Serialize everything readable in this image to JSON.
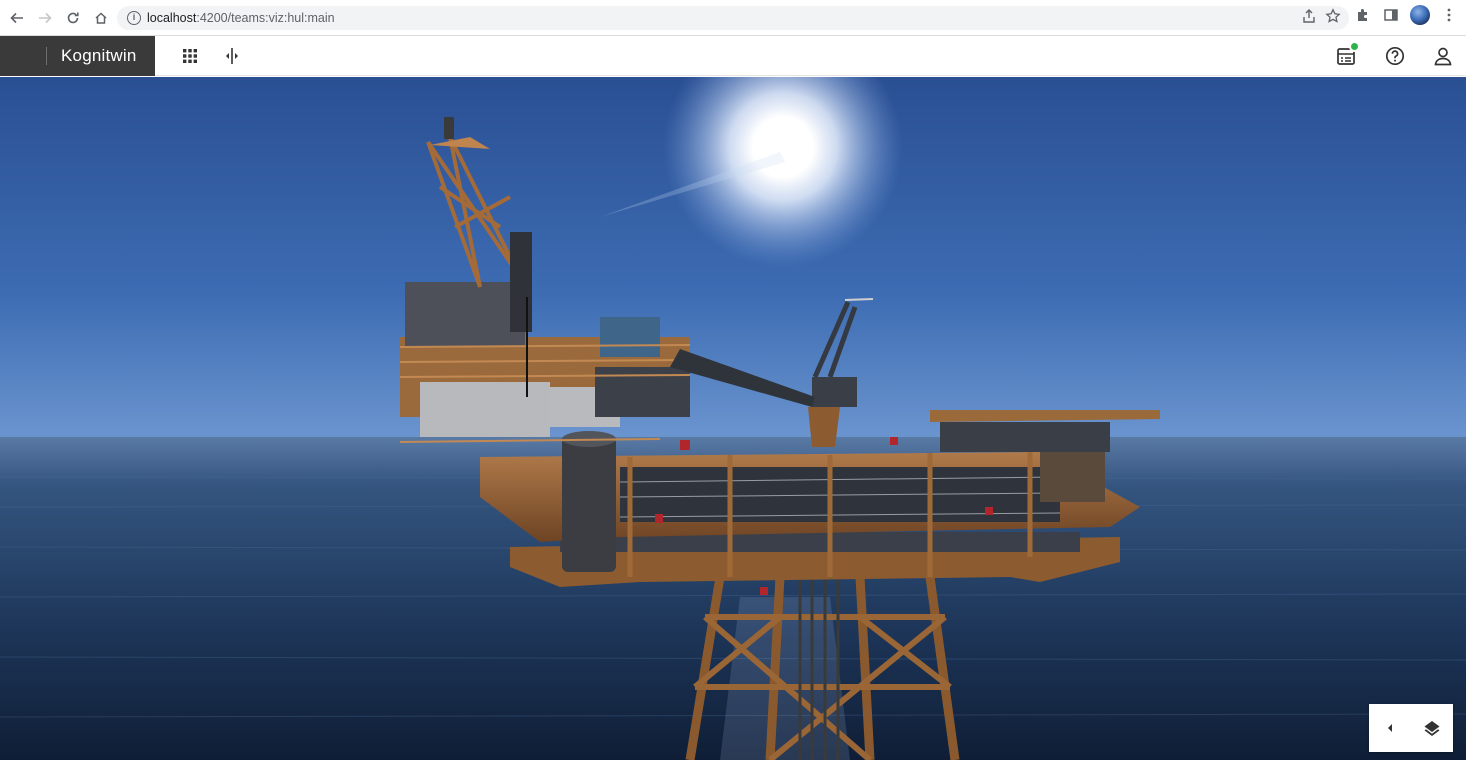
{
  "browser": {
    "url_host": "localhost",
    "url_path": ":4200/teams:viz:hul:main",
    "back_icon": "arrow-left-icon",
    "forward_icon": "arrow-right-icon",
    "reload_icon": "reload-icon",
    "home_icon": "home-icon"
  },
  "app": {
    "brand_name": "Kognitwin",
    "header_icons": [
      "apps-grid-icon",
      "split-view-icon",
      "notifications-list-icon",
      "help-icon",
      "user-icon"
    ],
    "badge_color": "#2db34a"
  },
  "viewer": {
    "scene": "offshore-platform",
    "controls": [
      "collapse-left-icon",
      "layers-icon"
    ]
  }
}
